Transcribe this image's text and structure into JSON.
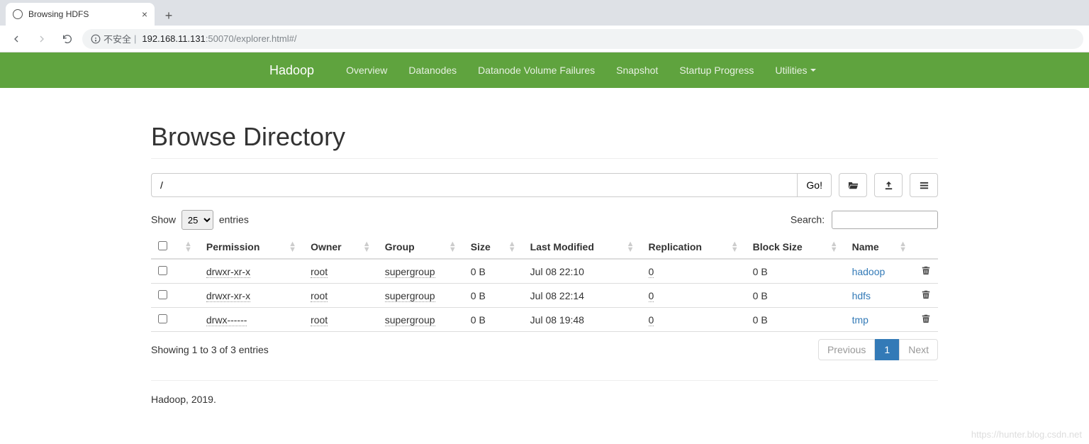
{
  "browser": {
    "tab_title": "Browsing HDFS",
    "security_text": "不安全",
    "url_host": "192.168.11.131",
    "url_port_path": ":50070/explorer.html#/"
  },
  "navbar": {
    "brand": "Hadoop",
    "items": [
      "Overview",
      "Datanodes",
      "Datanode Volume Failures",
      "Snapshot",
      "Startup Progress",
      "Utilities"
    ]
  },
  "page": {
    "title": "Browse Directory",
    "path_value": "/",
    "go_label": "Go!",
    "show_label_pre": "Show",
    "show_label_post": "entries",
    "entries_value": "25",
    "search_label": "Search:",
    "info_text": "Showing 1 to 3 of 3 entries",
    "pagination": {
      "prev": "Previous",
      "page": "1",
      "next": "Next"
    },
    "footer": "Hadoop, 2019."
  },
  "columns": [
    "Permission",
    "Owner",
    "Group",
    "Size",
    "Last Modified",
    "Replication",
    "Block Size",
    "Name"
  ],
  "rows": [
    {
      "permission": "drwxr-xr-x",
      "owner": "root",
      "group": "supergroup",
      "size": "0 B",
      "modified": "Jul 08 22:10",
      "replication": "0",
      "block_size": "0 B",
      "name": "hadoop"
    },
    {
      "permission": "drwxr-xr-x",
      "owner": "root",
      "group": "supergroup",
      "size": "0 B",
      "modified": "Jul 08 22:14",
      "replication": "0",
      "block_size": "0 B",
      "name": "hdfs"
    },
    {
      "permission": "drwx------",
      "owner": "root",
      "group": "supergroup",
      "size": "0 B",
      "modified": "Jul 08 19:48",
      "replication": "0",
      "block_size": "0 B",
      "name": "tmp"
    }
  ],
  "watermark": "https://hunter.blog.csdn.net"
}
